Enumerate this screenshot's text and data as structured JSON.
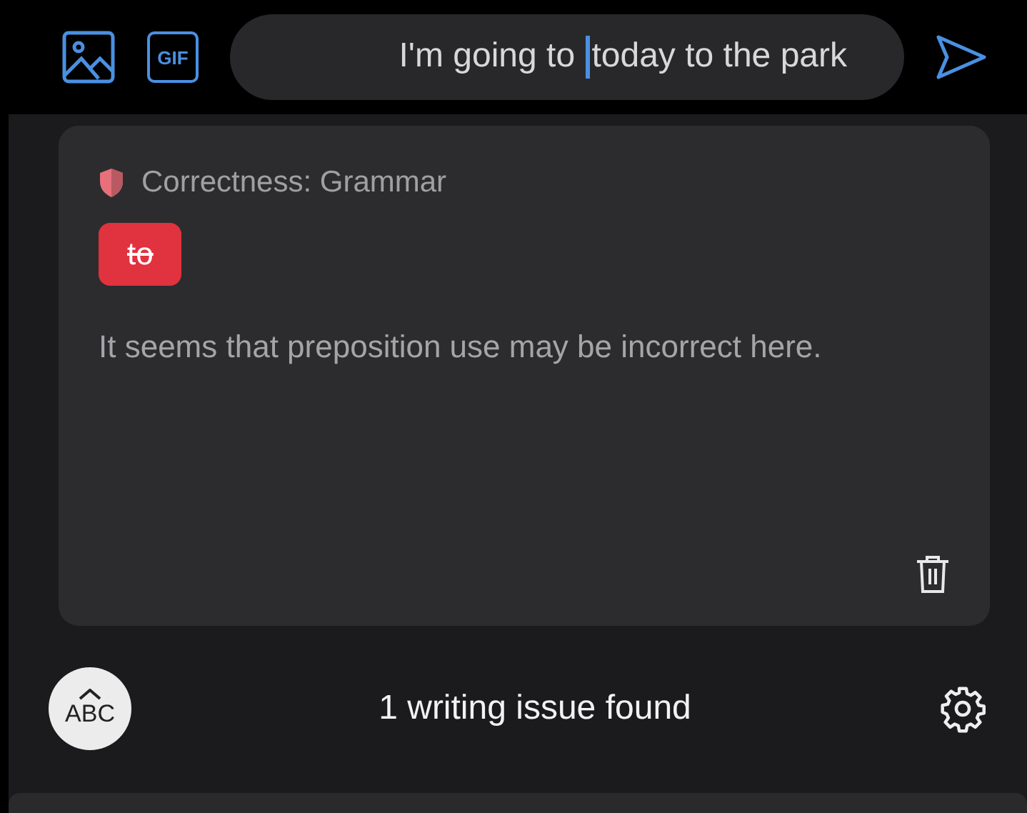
{
  "composer": {
    "text_before_cursor": "I'm going to ",
    "text_after_cursor": "today to the park",
    "gif_label": "GIF"
  },
  "suggestion": {
    "category": "Correctness: Grammar",
    "removed_word": "to",
    "message": "It seems that preposition use may be incorrect here."
  },
  "footer": {
    "abc_label": "ABC",
    "status": "1 writing issue found"
  }
}
